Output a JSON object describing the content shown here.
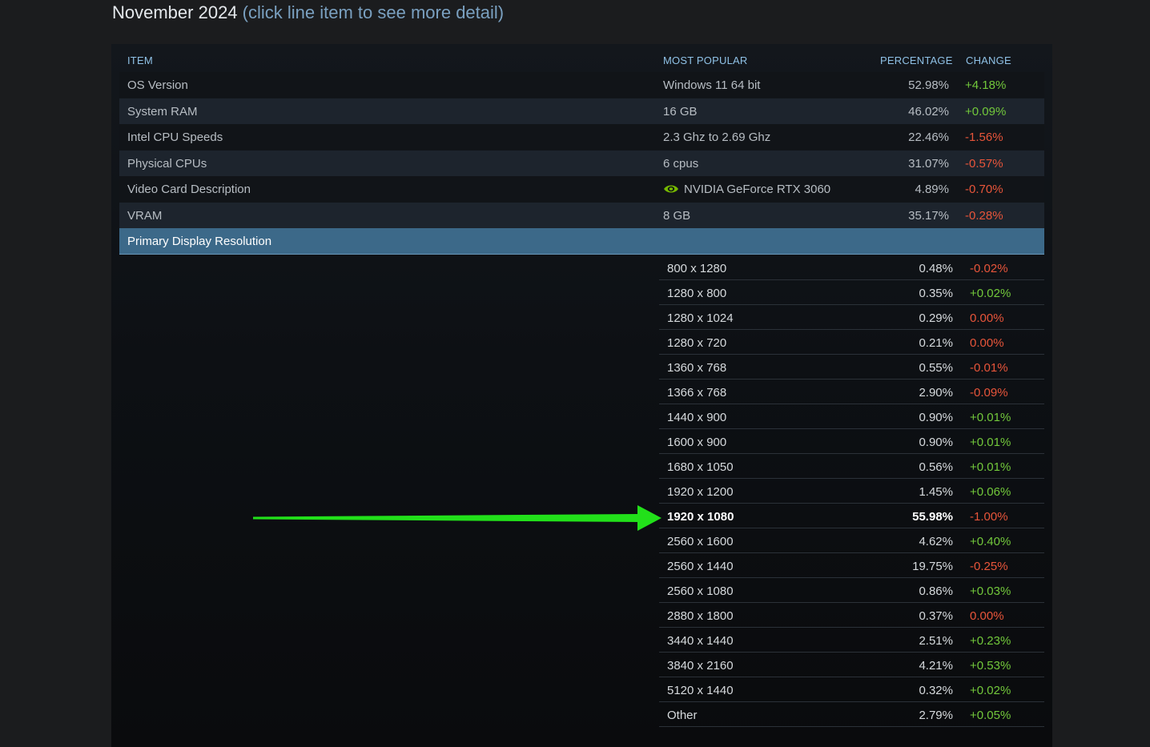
{
  "heading": {
    "title": "November 2024",
    "hint": "(click line item to see more detail)"
  },
  "columns": {
    "item": "ITEM",
    "most_popular": "MOST POPULAR",
    "percentage": "PERCENTAGE",
    "change": "CHANGE"
  },
  "rows": [
    {
      "item": "OS Version",
      "popular": "Windows 11 64 bit",
      "pct": "52.98%",
      "change": "+4.18%"
    },
    {
      "item": "System RAM",
      "popular": "16 GB",
      "pct": "46.02%",
      "change": "+0.09%"
    },
    {
      "item": "Intel CPU Speeds",
      "popular": "2.3 Ghz to 2.69 Ghz",
      "pct": "22.46%",
      "change": "-1.56%"
    },
    {
      "item": "Physical CPUs",
      "popular": "6 cpus",
      "pct": "31.07%",
      "change": "-0.57%"
    },
    {
      "item": "Video Card Description",
      "popular": "NVIDIA GeForce RTX 3060",
      "pct": "4.89%",
      "change": "-0.70%"
    },
    {
      "item": "VRAM",
      "popular": "8 GB",
      "pct": "35.17%",
      "change": "-0.28%"
    }
  ],
  "section": {
    "label": "Primary Display Resolution"
  },
  "resolutions": [
    {
      "res": "800 x 1280",
      "pct": "0.48%",
      "change": "-0.02%"
    },
    {
      "res": "1280 x 800",
      "pct": "0.35%",
      "change": "+0.02%"
    },
    {
      "res": "1280 x 1024",
      "pct": "0.29%",
      "change": "0.00%"
    },
    {
      "res": "1280 x 720",
      "pct": "0.21%",
      "change": "0.00%"
    },
    {
      "res": "1360 x 768",
      "pct": "0.55%",
      "change": "-0.01%"
    },
    {
      "res": "1366 x 768",
      "pct": "2.90%",
      "change": "-0.09%"
    },
    {
      "res": "1440 x 900",
      "pct": "0.90%",
      "change": "+0.01%"
    },
    {
      "res": "1600 x 900",
      "pct": "0.90%",
      "change": "+0.01%"
    },
    {
      "res": "1680 x 1050",
      "pct": "0.56%",
      "change": "+0.01%"
    },
    {
      "res": "1920 x 1200",
      "pct": "1.45%",
      "change": "+0.06%"
    },
    {
      "res": "1920 x 1080",
      "pct": "55.98%",
      "change": "-1.00%"
    },
    {
      "res": "2560 x 1600",
      "pct": "4.62%",
      "change": "+0.40%"
    },
    {
      "res": "2560 x 1440",
      "pct": "19.75%",
      "change": "-0.25%"
    },
    {
      "res": "2560 x 1080",
      "pct": "0.86%",
      "change": "+0.03%"
    },
    {
      "res": "2880 x 1800",
      "pct": "0.37%",
      "change": "0.00%"
    },
    {
      "res": "3440 x 1440",
      "pct": "2.51%",
      "change": "+0.23%"
    },
    {
      "res": "3840 x 2160",
      "pct": "4.21%",
      "change": "+0.53%"
    },
    {
      "res": "5120 x 1440",
      "pct": "0.32%",
      "change": "+0.02%"
    },
    {
      "res": "Other",
      "pct": "2.79%",
      "change": "+0.05%"
    }
  ],
  "colors": {
    "positive": "#72c83b",
    "negative": "#e8553a",
    "header_text": "#8fc1e6",
    "section_bg": "#3c6989",
    "annotation_arrow": "#22e01a"
  },
  "icons": {
    "video_card": "nvidia-logo-icon",
    "annotation": "green-arrow-icon"
  }
}
